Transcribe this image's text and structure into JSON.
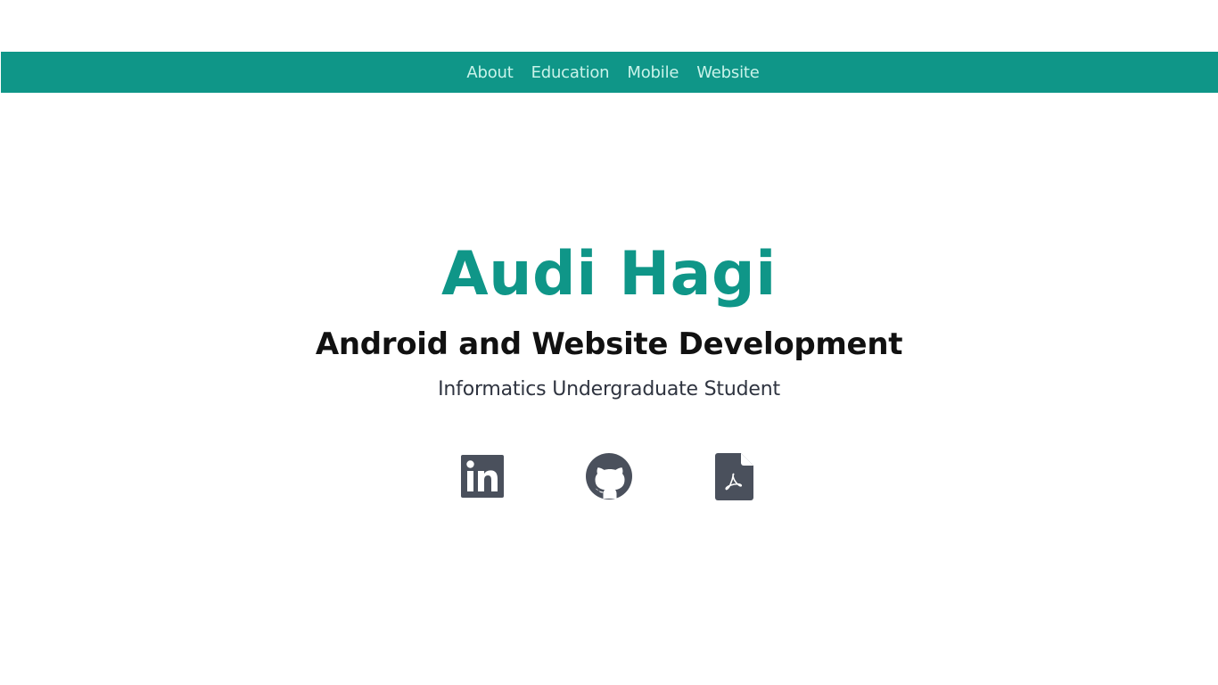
{
  "nav": {
    "items": [
      {
        "label": "About"
      },
      {
        "label": "Education"
      },
      {
        "label": "Mobile"
      },
      {
        "label": "Website"
      }
    ]
  },
  "hero": {
    "name": "Audi Hagi",
    "role": "Android and Website Development",
    "status": "Informatics Undergraduate Student"
  },
  "socials": {
    "icons": [
      "linkedin-icon",
      "github-icon",
      "pdf-file-icon"
    ]
  },
  "colors": {
    "accent": "#0f9688",
    "nav_text": "#c9f3ea",
    "icon": "#4a505c"
  }
}
